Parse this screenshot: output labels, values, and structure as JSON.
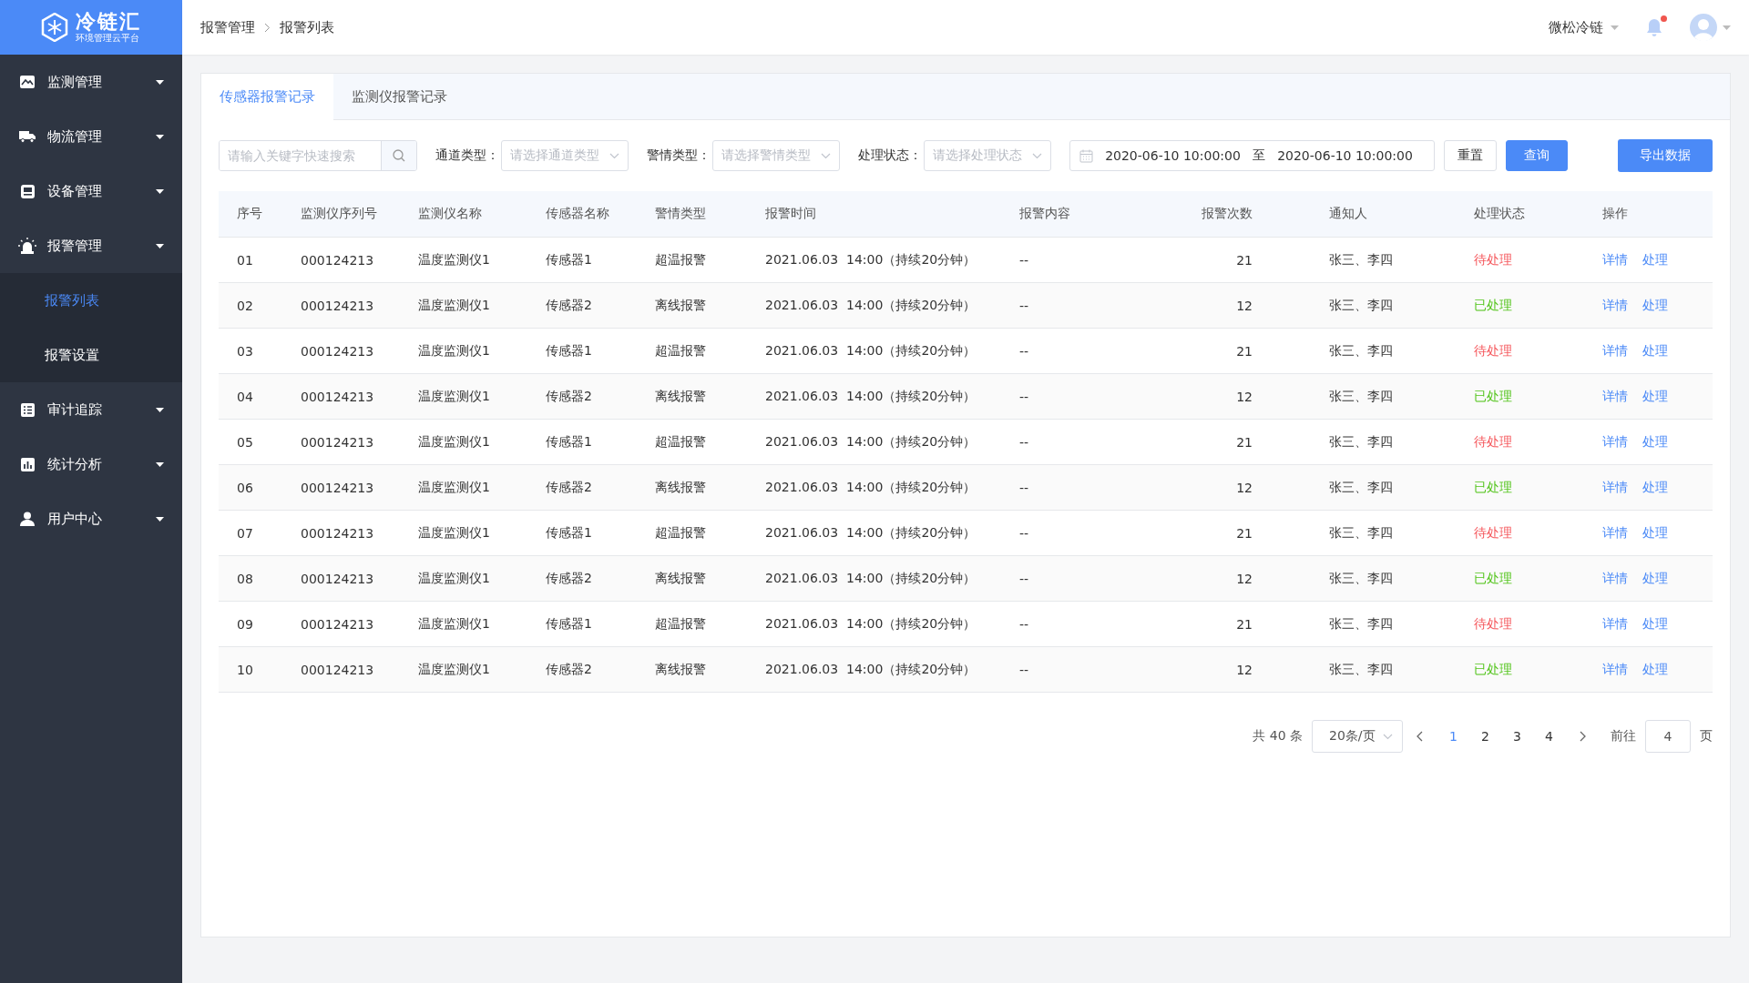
{
  "sidebar": {
    "logo": {
      "title": "冷链汇",
      "subtitle": "环境管理云平台"
    },
    "items": [
      {
        "label": "监测管理"
      },
      {
        "label": "物流管理"
      },
      {
        "label": "设备管理"
      },
      {
        "label": "报警管理",
        "children": [
          {
            "label": "报警列表",
            "selected": true
          },
          {
            "label": "报警设置",
            "selected": false
          }
        ]
      },
      {
        "label": "审计追踪"
      },
      {
        "label": "统计分析"
      },
      {
        "label": "用户中心"
      }
    ]
  },
  "header": {
    "breadcrumb": [
      "报警管理",
      "报警列表"
    ],
    "user": "微松冷链",
    "unread": true
  },
  "tabs": [
    {
      "label": "传感器报警记录",
      "selected": true
    },
    {
      "label": "监测仪报警记录",
      "selected": false
    }
  ],
  "filters": {
    "search": {
      "placeholder": "请输入关键字快速搜索"
    },
    "selects": [
      {
        "label": "通道类型：",
        "placeholder": "请选择通道类型"
      },
      {
        "label": "警情类型：",
        "placeholder": "请选择警情类型"
      },
      {
        "label": "处理状态：",
        "placeholder": "请选择处理状态"
      }
    ],
    "date_range": {
      "start": "2020-06-10 10:00:00",
      "separator": "至",
      "end": "2020-06-10 10:00:00"
    },
    "buttons": [
      {
        "label": "重置",
        "kind": "plain"
      },
      {
        "label": "查询",
        "kind": "primary"
      }
    ],
    "export": "导出数据"
  },
  "table": {
    "columns": [
      "序号",
      "监测仪序列号",
      "监测仪名称",
      "传感器名称",
      "警情类型",
      "报警时间",
      "报警内容",
      "报警次数",
      "通知人",
      "处理状态",
      "操作"
    ],
    "rows": [
      {
        "cells": [
          "01",
          "000124213",
          "温度监测仪1",
          "传感器1",
          "超温报警",
          "2021.06.03  14:00（持续20分钟）",
          "--",
          "21",
          "张三、李四"
        ],
        "status": {
          "label": "待处理",
          "color": "#f5565b"
        },
        "actions": [
          "详情",
          "处理"
        ]
      },
      {
        "cells": [
          "02",
          "000124213",
          "温度监测仪1",
          "传感器2",
          "离线报警",
          "2021.06.03  14:00（持续20分钟）",
          "--",
          "12",
          "张三、李四"
        ],
        "status": {
          "label": "已处理",
          "color": "#52c41a"
        },
        "actions": [
          "详情",
          "处理"
        ]
      },
      {
        "cells": [
          "03",
          "000124213",
          "温度监测仪1",
          "传感器1",
          "超温报警",
          "2021.06.03  14:00（持续20分钟）",
          "--",
          "21",
          "张三、李四"
        ],
        "status": {
          "label": "待处理",
          "color": "#f5565b"
        },
        "actions": [
          "详情",
          "处理"
        ]
      },
      {
        "cells": [
          "04",
          "000124213",
          "温度监测仪1",
          "传感器2",
          "离线报警",
          "2021.06.03  14:00（持续20分钟）",
          "--",
          "12",
          "张三、李四"
        ],
        "status": {
          "label": "已处理",
          "color": "#52c41a"
        },
        "actions": [
          "详情",
          "处理"
        ]
      },
      {
        "cells": [
          "05",
          "000124213",
          "温度监测仪1",
          "传感器1",
          "超温报警",
          "2021.06.03  14:00（持续20分钟）",
          "--",
          "21",
          "张三、李四"
        ],
        "status": {
          "label": "待处理",
          "color": "#f5565b"
        },
        "actions": [
          "详情",
          "处理"
        ]
      },
      {
        "cells": [
          "06",
          "000124213",
          "温度监测仪1",
          "传感器2",
          "离线报警",
          "2021.06.03  14:00（持续20分钟）",
          "--",
          "12",
          "张三、李四"
        ],
        "status": {
          "label": "已处理",
          "color": "#52c41a"
        },
        "actions": [
          "详情",
          "处理"
        ]
      },
      {
        "cells": [
          "07",
          "000124213",
          "温度监测仪1",
          "传感器1",
          "超温报警",
          "2021.06.03  14:00（持续20分钟）",
          "--",
          "21",
          "张三、李四"
        ],
        "status": {
          "label": "待处理",
          "color": "#f5565b"
        },
        "actions": [
          "详情",
          "处理"
        ]
      },
      {
        "cells": [
          "08",
          "000124213",
          "温度监测仪1",
          "传感器2",
          "离线报警",
          "2021.06.03  14:00（持续20分钟）",
          "--",
          "12",
          "张三、李四"
        ],
        "status": {
          "label": "已处理",
          "color": "#52c41a"
        },
        "actions": [
          "详情",
          "处理"
        ]
      },
      {
        "cells": [
          "09",
          "000124213",
          "温度监测仪1",
          "传感器1",
          "超温报警",
          "2021.06.03  14:00（持续20分钟）",
          "--",
          "21",
          "张三、李四"
        ],
        "status": {
          "label": "待处理",
          "color": "#f5565b"
        },
        "actions": [
          "详情",
          "处理"
        ]
      },
      {
        "cells": [
          "10",
          "000124213",
          "温度监测仪1",
          "传感器2",
          "离线报警",
          "2021.06.03  14:00（持续20分钟）",
          "--",
          "12",
          "张三、李四"
        ],
        "status": {
          "label": "已处理",
          "color": "#52c41a"
        },
        "actions": [
          "详情",
          "处理"
        ]
      }
    ]
  },
  "pagination": {
    "total": "共 40 条",
    "page_size": "20条/页",
    "pages": [
      {
        "label": "1",
        "selected": true
      },
      {
        "label": "2",
        "selected": false
      },
      {
        "label": "3",
        "selected": false
      },
      {
        "label": "4",
        "selected": false
      }
    ],
    "jump_label": "前往",
    "jump_value": "4",
    "jump_unit": "页"
  }
}
